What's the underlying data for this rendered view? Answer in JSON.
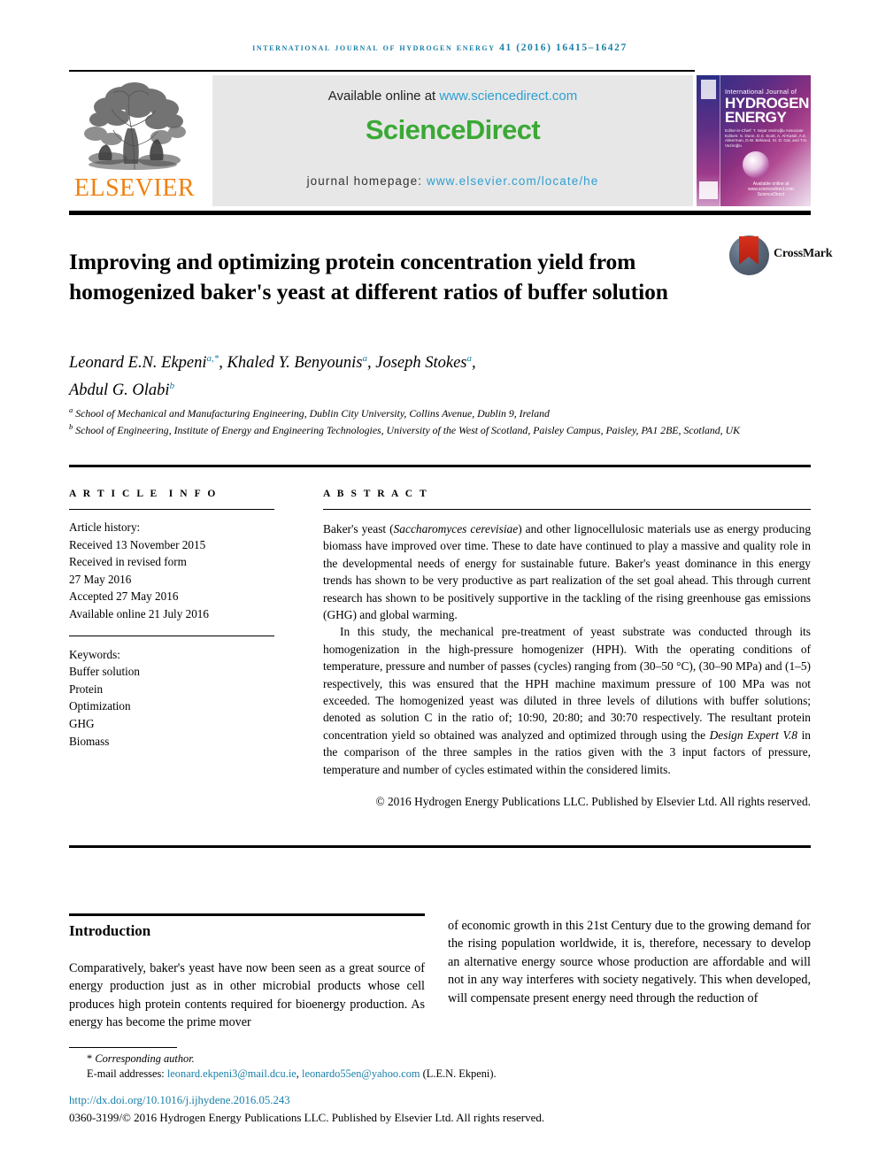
{
  "running_head": "International Journal of Hydrogen Energy 41 (2016) 16415–16427",
  "masthead": {
    "publisher_logo_label": "ELSEVIER",
    "available_prefix": "Available online at ",
    "available_url": "www.sciencedirect.com",
    "sciencedirect_logo": "ScienceDirect",
    "homepage_prefix": "journal homepage: ",
    "homepage_url": "www.elsevier.com/locate/he",
    "cover": {
      "line1": "International Journal of",
      "line2": "HYDROGEN",
      "line3": "ENERGY",
      "editors": "Editor-in-Chief: T. Nejat Veziroğlu    Associate Editors: S. Dunn, D.S. Scott, A. Al-Kasiri, A.E. Akkerman, D.W. Birkland, Sr. D. Gal, and T.N. Veziroğlu",
      "sciencedirect_footer": "Available online at www.sciencedirect.com  ScienceDirect"
    }
  },
  "crossmark": {
    "label": "CrossMark"
  },
  "article": {
    "title": "Improving and optimizing protein concentration yield from homogenized baker's yeast at different ratios of buffer solution",
    "authors": [
      {
        "name": "Leonard E.N. Ekpeni",
        "sup": "a,*"
      },
      {
        "name": "Khaled Y. Benyounis",
        "sup": "a"
      },
      {
        "name": "Joseph Stokes",
        "sup": "a"
      },
      {
        "name": "Abdul G. Olabi",
        "sup": "b"
      }
    ],
    "affiliations": [
      {
        "marker": "a",
        "text": "School of Mechanical and Manufacturing Engineering, Dublin City University, Collins Avenue, Dublin 9, Ireland"
      },
      {
        "marker": "b",
        "text": "School of Engineering, Institute of Energy and Engineering Technologies, University of the West of Scotland, Paisley Campus, Paisley, PA1 2BE, Scotland, UK"
      }
    ]
  },
  "article_info": {
    "heading": "ARTICLE INFO",
    "history_label": "Article history:",
    "history": [
      "Received 13 November 2015",
      "Received in revised form",
      "27 May 2016",
      "Accepted 27 May 2016",
      "Available online 21 July 2016"
    ],
    "keywords_label": "Keywords:",
    "keywords": [
      "Buffer solution",
      "Protein",
      "Optimization",
      "GHG",
      "Biomass"
    ]
  },
  "abstract": {
    "heading": "ABSTRACT",
    "paragraph1_part1": "Baker's yeast (",
    "paragraph1_italic": "Saccharomyces cerevisiae",
    "paragraph1_part2": ") and other lignocellulosic materials use as energy producing biomass have improved over time. These to date have continued to play a massive and quality role in the developmental needs of energy for sustainable future. Baker's yeast dominance in this energy trends has shown to be very productive as part realization of the set goal ahead. This through current research has shown to be positively supportive in the tackling of the rising greenhouse gas emissions (GHG) and global warming.",
    "paragraph2_part1": "In this study, the mechanical pre-treatment of yeast substrate was conducted through its homogenization in the high-pressure homogenizer (HPH). With the operating conditions of temperature, pressure and number of passes (cycles) ranging from (30–50 °C), (30–90 MPa) and (1–5) respectively, this was ensured that the HPH machine maximum pressure of 100 MPa was not exceeded. The homogenized yeast was diluted in three levels of dilutions with buffer solutions; denoted as solution C in the ratio of; 10:90, 20:80; and 30:70 respectively. The resultant protein concentration yield so obtained was analyzed and optimized through using the ",
    "paragraph2_italic": "Design Expert V.8",
    "paragraph2_part2": " in the comparison of the three samples in the ratios given with the 3 input factors of pressure, temperature and number of cycles estimated within the considered limits.",
    "copyright": "© 2016 Hydrogen Energy Publications LLC. Published by Elsevier Ltd. All rights reserved."
  },
  "body": {
    "intro_heading": "Introduction",
    "intro_left": "Comparatively, baker's yeast have now been seen as a great source of energy production just as in other microbial products whose cell produces high protein contents required for bioenergy production. As energy has become the prime mover",
    "intro_right": "of economic growth in this 21st Century due to the growing demand for the rising population worldwide, it is, therefore, necessary to develop an alternative energy source whose production are affordable and will not in any way interferes with society negatively. This when developed, will compensate present energy need through the reduction of"
  },
  "footer": {
    "corresponding_star": "*",
    "corresponding_label": "Corresponding author.",
    "email_label": "E-mail addresses:",
    "email1": "leonard.ekpeni3@mail.dcu.ie",
    "email_sep": ", ",
    "email2": "leonardo55en@yahoo.com",
    "email_owner": "(L.E.N. Ekpeni).",
    "doi": "http://dx.doi.org/10.1016/j.ijhydene.2016.05.243",
    "issn_line": "0360-3199/© 2016 Hydrogen Energy Publications LLC. Published by Elsevier Ltd. All rights reserved."
  },
  "colors": {
    "link": "#1a7fa8",
    "elsevier_orange": "#F08010",
    "sciencedirect_green": "#3aa935",
    "sciencedirect_blue": "#2f9fd0"
  }
}
